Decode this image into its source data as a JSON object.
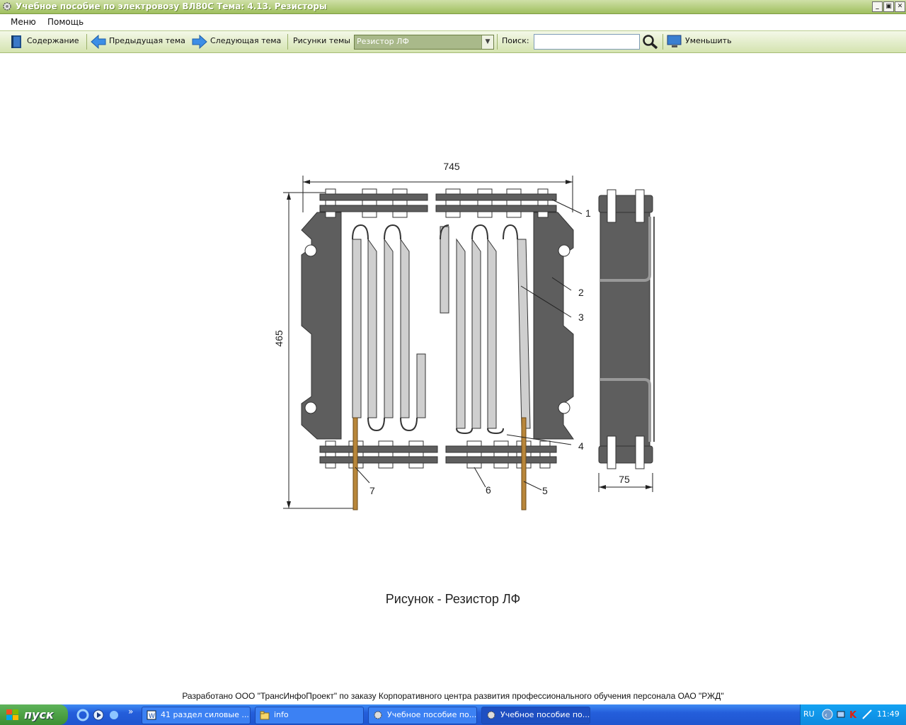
{
  "window": {
    "title": "Учебное пособие по электровозу ВЛ80С Тема: 4.13. Резисторы",
    "minimize_icon": "minimize-icon",
    "maximize_icon": "restore-icon",
    "close_icon": "close-icon"
  },
  "menubar": {
    "items": [
      "Меню",
      "Помощь"
    ]
  },
  "toolbar": {
    "contents_label": "Содержание",
    "prev_label": "Предыдущая тема",
    "next_label": "Следующая тема",
    "figures_label": "Рисунки темы",
    "figure_selected": "Резистор ЛФ",
    "search_label": "Поиск:",
    "search_value": "",
    "reduce_label": "Уменьшить"
  },
  "figure": {
    "dim_width": "745",
    "dim_height": "465",
    "dim_side": "75",
    "callouts": [
      "1",
      "2",
      "3",
      "4",
      "5",
      "6",
      "7"
    ],
    "caption": "Рисунок - Резистор ЛФ",
    "colors": {
      "frame": "#5e5e5e",
      "element": "#cfcfcf",
      "lead": "#b8863a"
    }
  },
  "footer": {
    "text": "Разработано ООО \"ТрансИнфоПроект\" по заказу Корпоративного центра развития профессионального обучения персонала ОАО \"РЖД\""
  },
  "taskbar": {
    "start_label": "пуск",
    "tasks": [
      "41 раздел силовые ...",
      "info",
      "Учебное пособие по...",
      "Учебное пособие по..."
    ],
    "language": "RU",
    "clock": "11:49"
  }
}
